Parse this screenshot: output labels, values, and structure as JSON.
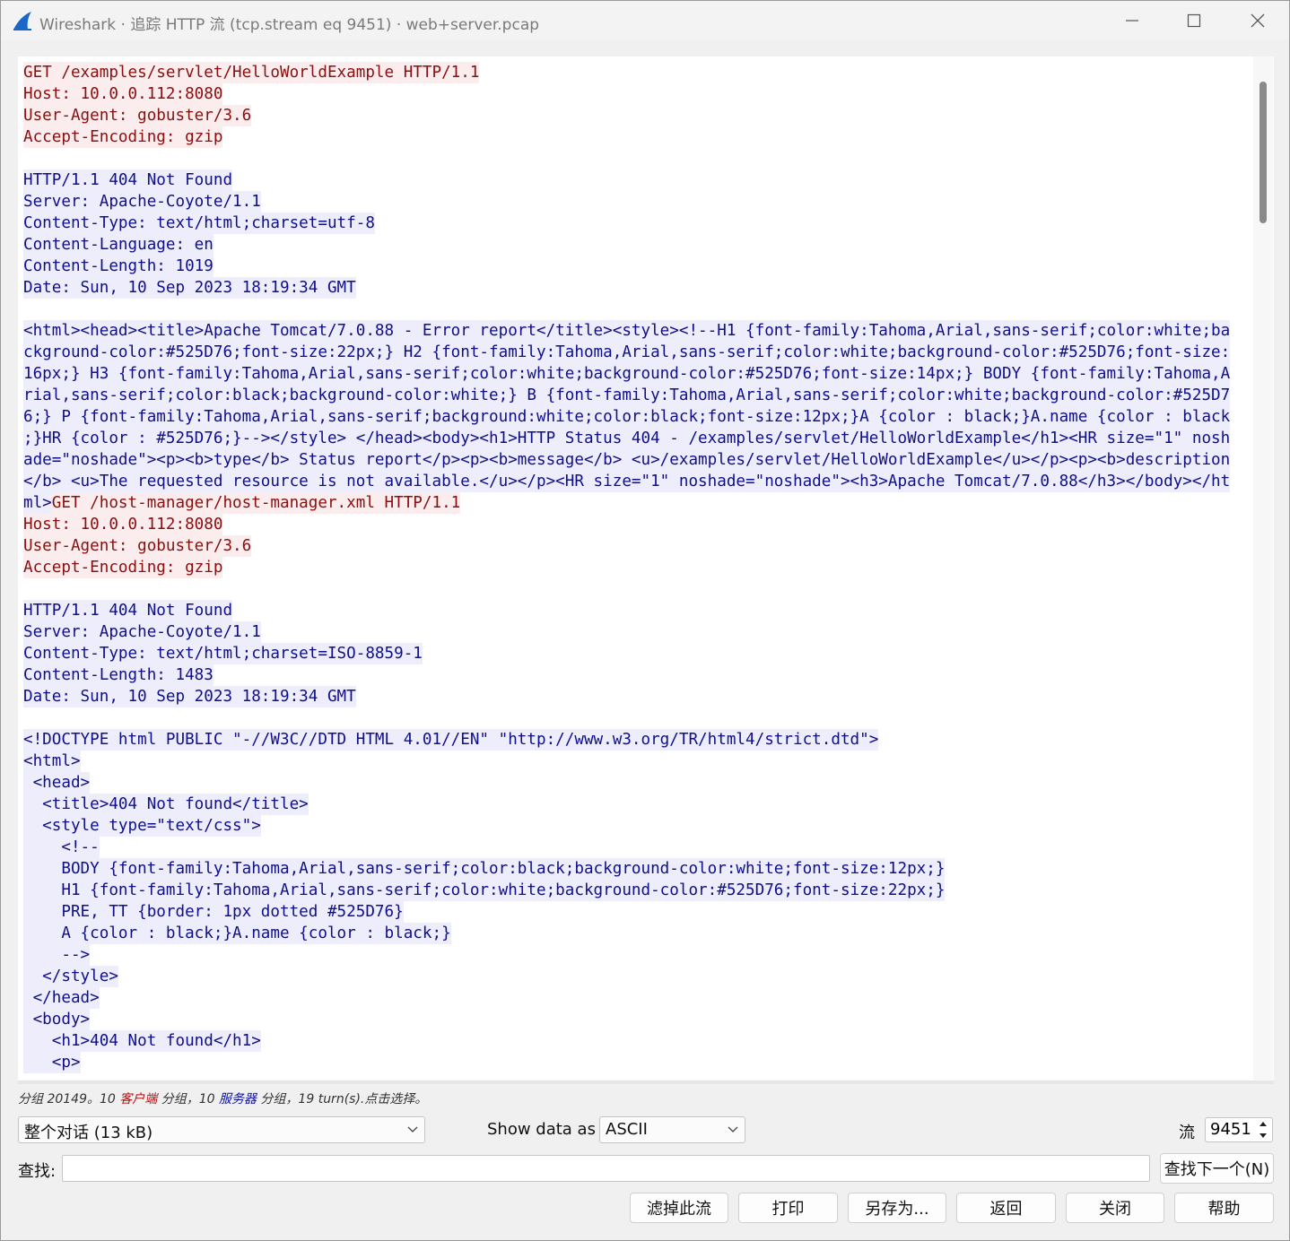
{
  "window": {
    "title": "Wireshark · 追踪 HTTP 流 (tcp.stream eq 9451) · web+server.pcap"
  },
  "colors": {
    "client_bg": "#fbeded",
    "client_fg": "#8b0e0e",
    "server_bg": "#ededfb",
    "server_fg": "#0f0f8b"
  },
  "stream": {
    "lines": [
      {
        "who": "c",
        "text": "GET /examples/servlet/HelloWorldExample HTTP/1.1"
      },
      {
        "who": "c",
        "text": "Host: 10.0.0.112:8080"
      },
      {
        "who": "c",
        "text": "User-Agent: gobuster/3.6"
      },
      {
        "who": "c",
        "text": "Accept-Encoding: gzip"
      },
      {
        "who": "",
        "text": ""
      },
      {
        "who": "s",
        "text": "HTTP/1.1 404 Not Found"
      },
      {
        "who": "s",
        "text": "Server: Apache-Coyote/1.1"
      },
      {
        "who": "s",
        "text": "Content-Type: text/html;charset=utf-8"
      },
      {
        "who": "s",
        "text": "Content-Language: en"
      },
      {
        "who": "s",
        "text": "Content-Length: 1019"
      },
      {
        "who": "s",
        "text": "Date: Sun, 10 Sep 2023 18:19:34 GMT"
      },
      {
        "who": "",
        "text": ""
      },
      {
        "who": "s",
        "text": "<html><head><title>Apache Tomcat/7.0.88 - Error report</title><style><!--H1 {font-family:Tahoma,Arial,sans-serif;color:white;ba"
      },
      {
        "who": "s",
        "text": "ckground-color:#525D76;font-size:22px;} H2 {font-family:Tahoma,Arial,sans-serif;color:white;background-color:#525D76;font-size:"
      },
      {
        "who": "s",
        "text": "16px;} H3 {font-family:Tahoma,Arial,sans-serif;color:white;background-color:#525D76;font-size:14px;} BODY {font-family:Tahoma,A"
      },
      {
        "who": "s",
        "text": "rial,sans-serif;color:black;background-color:white;} B {font-family:Tahoma,Arial,sans-serif;color:white;background-color:#525D7"
      },
      {
        "who": "s",
        "text": "6;} P {font-family:Tahoma,Arial,sans-serif;background:white;color:black;font-size:12px;}A {color : black;}A.name {color : black"
      },
      {
        "who": "s",
        "text": ";}HR {color : #525D76;}--></style> </head><body><h1>HTTP Status 404 - /examples/servlet/HelloWorldExample</h1><HR size=\"1\" nosh"
      },
      {
        "who": "s",
        "text": "ade=\"noshade\"><p><b>type</b> Status report</p><p><b>message</b> <u>/examples/servlet/HelloWorldExample</u></p><p><b>description"
      },
      {
        "who": "s",
        "text": "</b> <u>The requested resource is not available.</u></p><HR size=\"1\" noshade=\"noshade\"><h3>Apache Tomcat/7.0.88</h3></body></ht"
      },
      {
        "who": "mix",
        "text": "ml>",
        "text2": "GET /host-manager/host-manager.xml HTTP/1.1"
      },
      {
        "who": "c",
        "text": "Host: 10.0.0.112:8080"
      },
      {
        "who": "c",
        "text": "User-Agent: gobuster/3.6"
      },
      {
        "who": "c",
        "text": "Accept-Encoding: gzip"
      },
      {
        "who": "",
        "text": ""
      },
      {
        "who": "s",
        "text": "HTTP/1.1 404 Not Found"
      },
      {
        "who": "s",
        "text": "Server: Apache-Coyote/1.1"
      },
      {
        "who": "s",
        "text": "Content-Type: text/html;charset=ISO-8859-1"
      },
      {
        "who": "s",
        "text": "Content-Length: 1483"
      },
      {
        "who": "s",
        "text": "Date: Sun, 10 Sep 2023 18:19:34 GMT"
      },
      {
        "who": "",
        "text": ""
      },
      {
        "who": "s",
        "text": "<!DOCTYPE html PUBLIC \"-//W3C//DTD HTML 4.01//EN\" \"http://www.w3.org/TR/html4/strict.dtd\">"
      },
      {
        "who": "s",
        "text": "<html>"
      },
      {
        "who": "s",
        "text": " <head>"
      },
      {
        "who": "s",
        "text": "  <title>404 Not found</title>"
      },
      {
        "who": "s",
        "text": "  <style type=\"text/css\">"
      },
      {
        "who": "s",
        "text": "    <!--"
      },
      {
        "who": "s",
        "text": "    BODY {font-family:Tahoma,Arial,sans-serif;color:black;background-color:white;font-size:12px;}"
      },
      {
        "who": "s",
        "text": "    H1 {font-family:Tahoma,Arial,sans-serif;color:white;background-color:#525D76;font-size:22px;}"
      },
      {
        "who": "s",
        "text": "    PRE, TT {border: 1px dotted #525D76}"
      },
      {
        "who": "s",
        "text": "    A {color : black;}A.name {color : black;}"
      },
      {
        "who": "s",
        "text": "    -->"
      },
      {
        "who": "s",
        "text": "  </style>"
      },
      {
        "who": "s",
        "text": " </head>"
      },
      {
        "who": "s",
        "text": " <body>"
      },
      {
        "who": "s",
        "text": "   <h1>404 Not found</h1>"
      },
      {
        "who": "s",
        "text": "   <p>"
      }
    ]
  },
  "status": {
    "prefix": "分组 20149。10 ",
    "client_word": "客户端",
    "mid": " 分组，10 ",
    "server_word": "服务器",
    "suffix": " 分组，19 turn(s).点击选择。"
  },
  "controls": {
    "conversation_select": "整个对话 (13 kB)",
    "show_data_label": "Show data as",
    "show_data_value": "ASCII",
    "stream_label": "流",
    "stream_value": "9451",
    "find_label": "查找:",
    "find_value": "",
    "find_next_button": "查找下一个(N)"
  },
  "buttons": {
    "filter_out": "滤掉此流",
    "print": "打印",
    "save_as": "另存为...",
    "back": "返回",
    "close": "关闭",
    "help": "帮助"
  }
}
